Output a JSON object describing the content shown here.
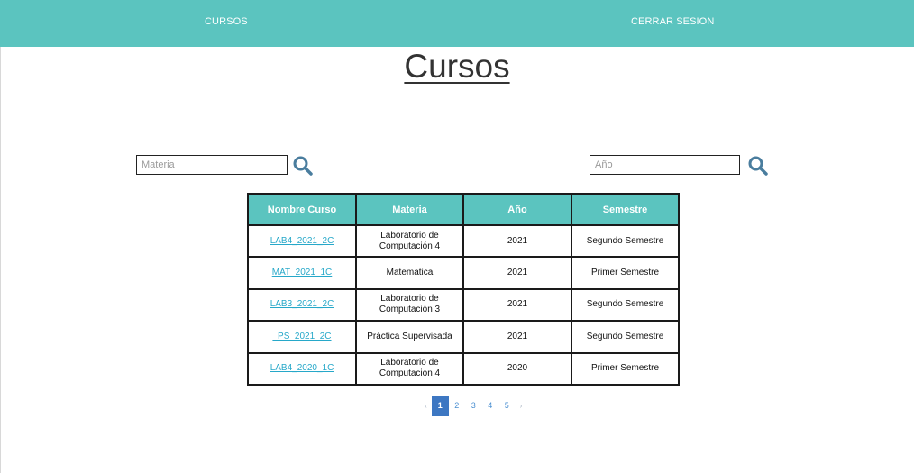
{
  "navbar": {
    "cursos_label": "CURSOS",
    "logout_label": "CERRAR SESION"
  },
  "page": {
    "title": "Cursos"
  },
  "search": {
    "materia_placeholder": "Materia",
    "anio_placeholder": "Año"
  },
  "table": {
    "headers": [
      "Nombre Curso",
      "Materia",
      "Año",
      "Semestre"
    ],
    "rows": [
      {
        "nombre": "LAB4_2021_2C",
        "materia": "Laboratorio de Computación 4",
        "anio": "2021",
        "semestre": "Segundo Semestre"
      },
      {
        "nombre": "MAT_2021_1C",
        "materia": "Matematica",
        "anio": "2021",
        "semestre": "Primer Semestre"
      },
      {
        "nombre": "LAB3_2021_2C",
        "materia": "Laboratorio de Computación 3",
        "anio": "2021",
        "semestre": "Segundo Semestre"
      },
      {
        "nombre": "_PS_2021_2C",
        "materia": "Práctica Supervisada",
        "anio": "2021",
        "semestre": "Segundo Semestre"
      },
      {
        "nombre": "LAB4_2020_1C",
        "materia": "Laboratorio de Computacion 4",
        "anio": "2020",
        "semestre": "Primer Semestre"
      }
    ]
  },
  "pagination": {
    "prev": "‹",
    "pages": [
      "1",
      "2",
      "3",
      "4",
      "5"
    ],
    "active": "1",
    "next": "›"
  },
  "colors": {
    "accent": "#5bc4bf",
    "link": "#27a8c9",
    "pagination_active": "#3d77c2",
    "search_icon": "#4a7d9e"
  },
  "icons": {
    "search": "search-icon"
  }
}
